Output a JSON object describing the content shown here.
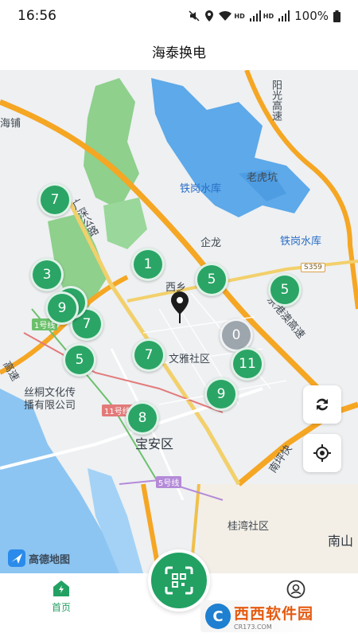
{
  "status_bar": {
    "time": "16:56",
    "battery": "100%",
    "icons": [
      "mute-icon",
      "location-icon",
      "wifi-icon",
      "signal-icon",
      "signal-icon",
      "battery-icon"
    ],
    "hd_labels": [
      "HD",
      "HD"
    ]
  },
  "header": {
    "title": "海泰换电"
  },
  "map": {
    "labels": {
      "tiegang_reservoir": "铁岗水库",
      "tiegang_reservoir_2": "铁岗水库",
      "laohukeng": "老虎坑",
      "qilong": "企龙",
      "xixiang": "西乡",
      "wenya": "文雅社区",
      "baoan": "宝安区",
      "guiwan": "桂湾社区",
      "nanshan": "南山",
      "sitong": "丝桐文化传播有限公司",
      "haipu": "海铺",
      "yanguang": "阳光高速",
      "guangzhou_road": "广深公路",
      "jinggang": "京港澳高速",
      "nanping": "南坪快",
      "gaosu_left": "高速",
      "road_s359": "S359",
      "line_1": "1号线",
      "line_11": "11号线",
      "line_5": "5号线"
    },
    "clusters": [
      {
        "count": "7",
        "status": "available"
      },
      {
        "count": "1",
        "status": "available"
      },
      {
        "count": "5",
        "status": "available"
      },
      {
        "count": "5",
        "status": "available"
      },
      {
        "count": "3",
        "status": "available"
      },
      {
        "count": "9",
        "status": "available"
      },
      {
        "count": "7",
        "status": "available"
      },
      {
        "count": "0",
        "status": "inactive"
      },
      {
        "count": "7",
        "status": "available"
      },
      {
        "count": "11",
        "status": "available"
      },
      {
        "count": "5",
        "status": "available"
      },
      {
        "count": "9",
        "status": "available"
      },
      {
        "count": "8",
        "status": "available"
      }
    ],
    "provider_logo": "高德地图",
    "controls": {
      "refresh_icon": "refresh-icon",
      "locate_icon": "locate-icon"
    }
  },
  "tab_bar": {
    "home_label": "首页",
    "profile_icon": "user-icon",
    "scan_icon": "scan-icon"
  },
  "watermark": {
    "brand": "西西软件园",
    "url": "CR173.COM"
  },
  "colors": {
    "primary": "#22a163",
    "cluster": "#2aa565",
    "cluster_inactive": "#9da5ad",
    "water": "#5da9e9",
    "highway": "#f5a623",
    "park": "#8ed08c"
  }
}
